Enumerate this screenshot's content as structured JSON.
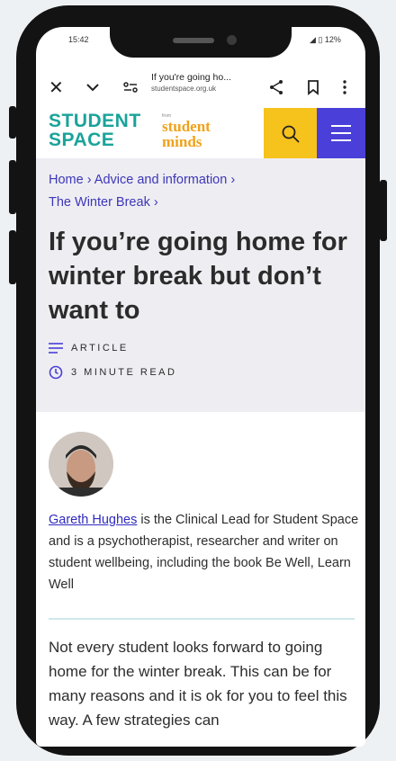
{
  "status_bar": {
    "time": "15:42",
    "battery": "12%"
  },
  "browser": {
    "page_title": "If you're going ho...",
    "url": "studentspace.org.uk"
  },
  "site_header": {
    "logo_line1": "STUDENT",
    "logo_line2": "SPACE",
    "partner_small": "from",
    "partner_line1": "student",
    "partner_line2": "minds"
  },
  "breadcrumb": {
    "items": [
      "Home",
      "Advice and information",
      "The Winter Break"
    ],
    "separator": "›"
  },
  "article": {
    "title": "If you’re going home for winter break but don’t want to",
    "type_label": "ARTICLE",
    "read_time": "3 MINUTE READ"
  },
  "author": {
    "name": "Gareth Hughes",
    "bio": " is the Clinical Lead for Student Space and is a psychotherapist, researcher and writer on student wellbeing, including the book Be Well, Learn Well"
  },
  "body": {
    "intro": "Not every student looks forward to going home for the winter break. This can be for many reasons and it is ok for you to feel this way. A few strategies can"
  },
  "colors": {
    "brand_teal": "#1aa39a",
    "brand_orange": "#f0a21a",
    "search_yellow": "#f6c21c",
    "menu_purple": "#4a3fd8",
    "link_purple": "#3d37b8",
    "hero_bg": "#eeedf2"
  }
}
